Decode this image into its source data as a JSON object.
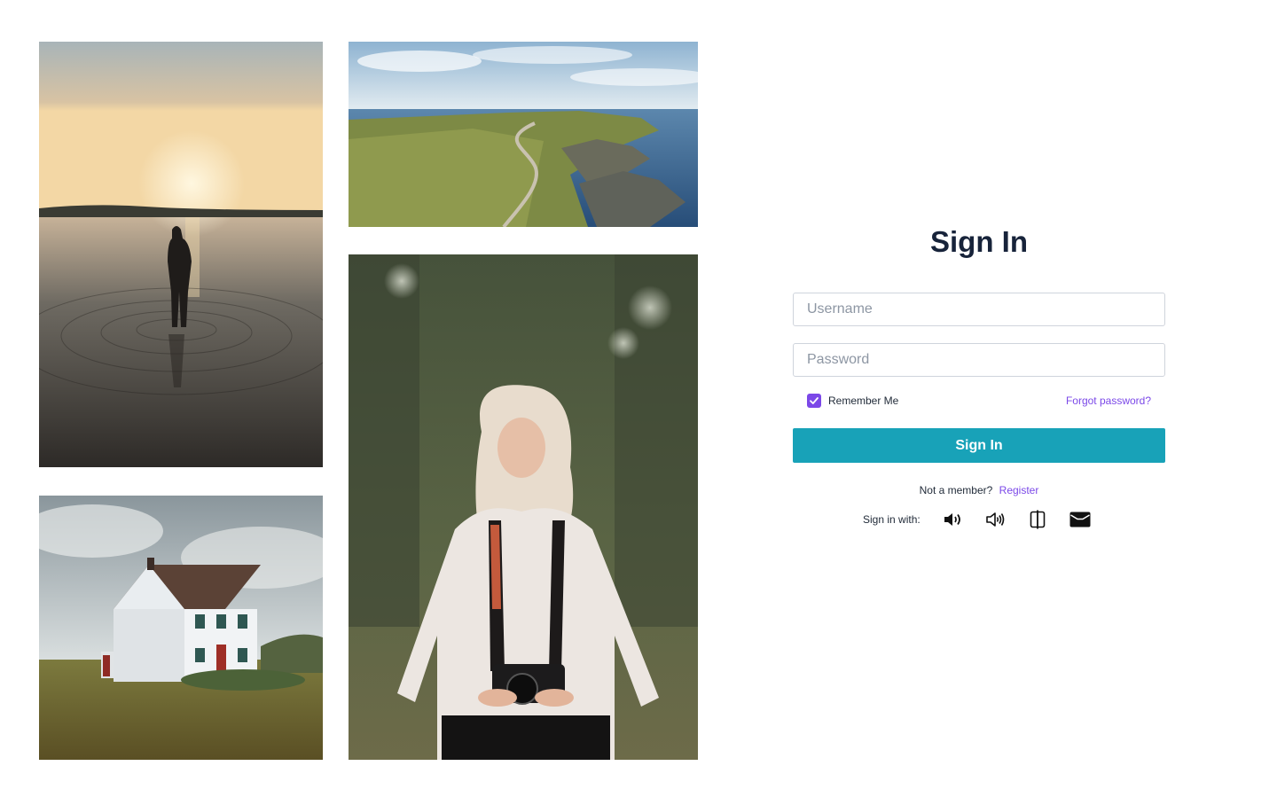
{
  "signin": {
    "title": "Sign In",
    "username_placeholder": "Username",
    "password_placeholder": "Password",
    "remember_label": "Remember Me",
    "remember_checked": true,
    "forgot_label": "Forgot password?",
    "submit_label": "Sign In",
    "not_member_text": "Not a member?",
    "register_label": "Register",
    "social_label": "Sign in with:",
    "social_icons": [
      "volume-icon",
      "volume-loud-icon",
      "split-view-icon",
      "wallet-icon"
    ]
  },
  "colors": {
    "accent": "#7b48e8",
    "primary_button": "#18a2b8",
    "heading": "#17233a"
  },
  "gallery": [
    "sunset-lake-photo",
    "coastline-photo",
    "white-house-photo",
    "woman-camera-photo"
  ]
}
